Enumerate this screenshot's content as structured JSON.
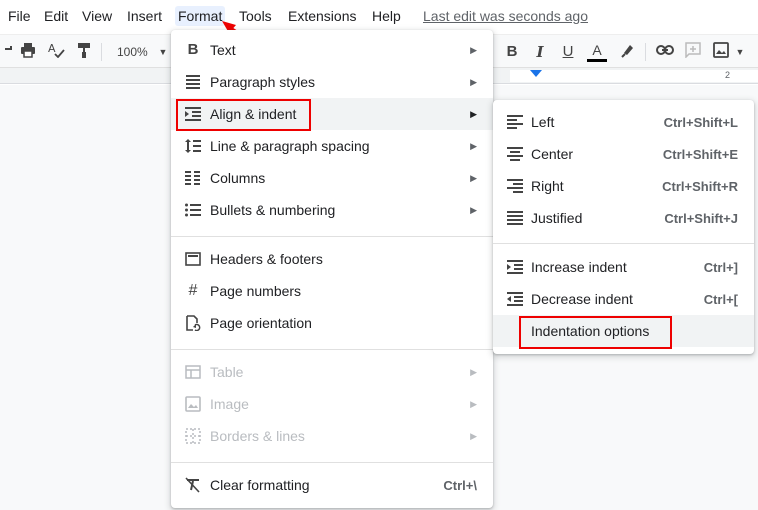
{
  "menubar": {
    "items": [
      "File",
      "Edit",
      "View",
      "Insert",
      "Format",
      "Tools",
      "Extensions",
      "Help"
    ],
    "last_edit": "Last edit was seconds ago"
  },
  "toolbar": {
    "zoom": "100%",
    "icons": [
      "print-icon",
      "spellcheck-icon",
      "paint-format-icon",
      "bold-icon",
      "italic-icon",
      "underline-icon",
      "text-color-icon",
      "highlight-icon",
      "link-icon",
      "comment-icon",
      "image-icon"
    ],
    "bold": "B",
    "italic": "I",
    "underline": "U",
    "text_color": "A",
    "text_color_hex": "#000000"
  },
  "ruler": {
    "number": "2",
    "marker_color": "#1a73e8"
  },
  "format_menu": {
    "items": [
      {
        "label": "Text",
        "icon": "bold-icon"
      },
      {
        "label": "Paragraph styles",
        "icon": "paragraph-styles-icon"
      },
      {
        "label": "Align & indent",
        "icon": "align-indent-icon"
      },
      {
        "label": "Line & paragraph spacing",
        "icon": "line-spacing-icon"
      },
      {
        "label": "Columns",
        "icon": "columns-icon"
      },
      {
        "label": "Bullets & numbering",
        "icon": "bullets-icon"
      },
      {
        "label": "Headers & footers",
        "icon": "headers-footers-icon"
      },
      {
        "label": "Page numbers",
        "icon": "hash-icon"
      },
      {
        "label": "Page orientation",
        "icon": "page-orientation-icon"
      },
      {
        "label": "Table",
        "icon": "table-icon"
      },
      {
        "label": "Image",
        "icon": "image-icon"
      },
      {
        "label": "Borders & lines",
        "icon": "borders-icon"
      },
      {
        "label": "Clear formatting",
        "icon": "clear-formatting-icon",
        "shortcut": "Ctrl+\\"
      }
    ]
  },
  "submenu": {
    "items": [
      {
        "label": "Left",
        "shortcut": "Ctrl+Shift+L",
        "icon": "align-left-icon"
      },
      {
        "label": "Center",
        "shortcut": "Ctrl+Shift+E",
        "icon": "align-center-icon"
      },
      {
        "label": "Right",
        "shortcut": "Ctrl+Shift+R",
        "icon": "align-right-icon"
      },
      {
        "label": "Justified",
        "shortcut": "Ctrl+Shift+J",
        "icon": "align-justify-icon"
      },
      {
        "label": "Increase indent",
        "shortcut": "Ctrl+]",
        "icon": "increase-indent-icon"
      },
      {
        "label": "Decrease indent",
        "shortcut": "Ctrl+[",
        "icon": "decrease-indent-icon"
      },
      {
        "label": "Indentation options"
      }
    ]
  },
  "annotation_color": "#e00000"
}
